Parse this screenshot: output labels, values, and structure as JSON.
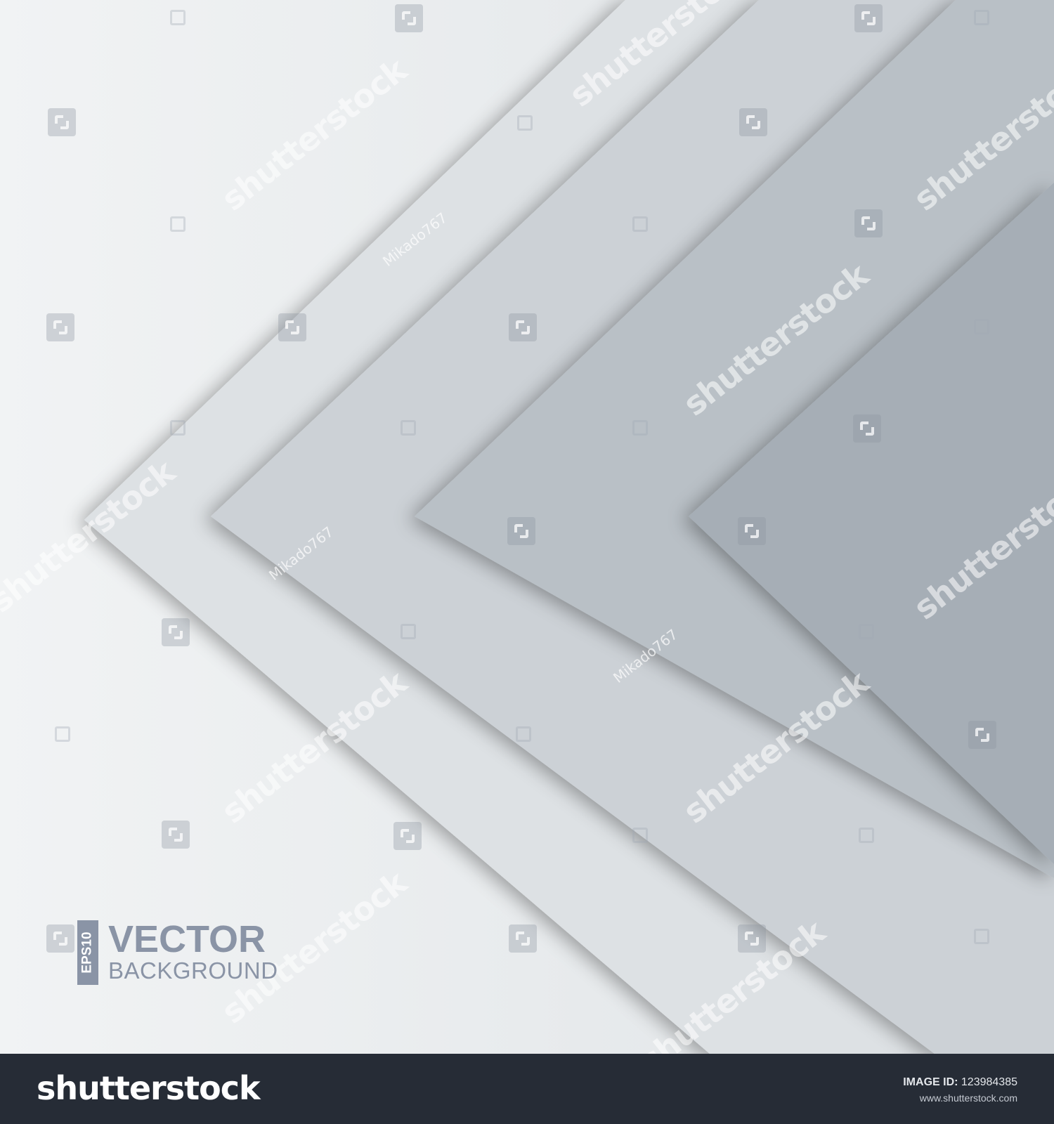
{
  "colors": {
    "background_light": "#e8ebed",
    "chevron_1": "#dde1e4",
    "chevron_2": "#ccd1d6",
    "chevron_3": "#b9c0c6",
    "chevron_4": "#a6aeb6",
    "badge_gray": "#8a94a6",
    "footer_dark": "#262c36"
  },
  "badge": {
    "eps_label": "EPS10",
    "vector_label": "VECTOR",
    "background_label": "BACKGROUND"
  },
  "watermark": {
    "brand": "shutterstock",
    "author": "Mikado767"
  },
  "footer": {
    "logo": "shutterstock",
    "image_id_label": "IMAGE ID:",
    "image_id_value": "123984385",
    "site_url": "www.shutterstock.com"
  }
}
